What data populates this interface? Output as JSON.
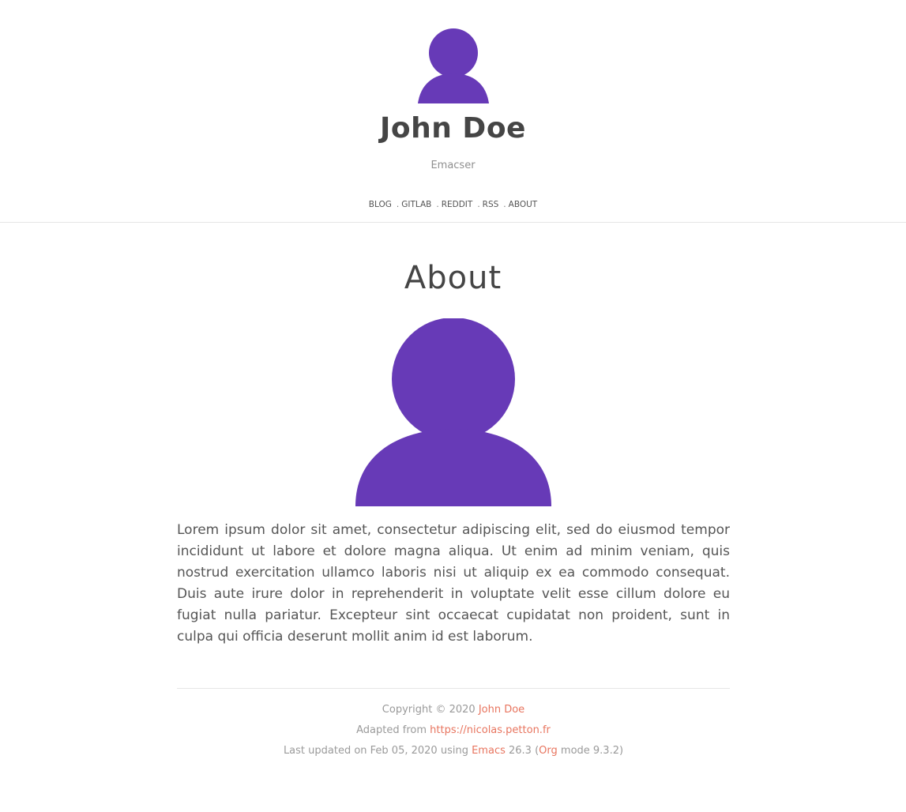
{
  "header": {
    "title": "John Doe",
    "subtitle": "Emacser",
    "nav": [
      "BLOG",
      "GITLAB",
      "REDDIT",
      "RSS",
      "ABOUT"
    ],
    "nav_separator": "."
  },
  "main": {
    "title": "About",
    "body": "Lorem ipsum dolor sit amet, consectetur adipiscing elit, sed do eiusmod tempor incididunt ut labore et dolore magna aliqua. Ut enim ad minim veniam, quis nostrud exercitation ullamco laboris nisi ut aliquip ex ea commodo consequat. Duis aute irure dolor in reprehenderit in voluptate velit esse cillum dolore eu fugiat nulla pariatur. Excepteur sint occaecat cupidatat non proident, sunt in culpa qui officia deserunt mollit anim id est laborum."
  },
  "footer": {
    "copyright_prefix": "Copyright © 2020",
    "copyright_link": "John Doe",
    "adapted_prefix": "Adapted from",
    "adapted_link": "https://nicolas.petton.fr",
    "updated_prefix": "Last updated on Feb 05, 2020 using",
    "emacs_link": "Emacs",
    "emacs_version": "26.3 (",
    "org_link": "Org",
    "org_version": "mode 9.3.2)"
  },
  "colors": {
    "avatar": "#673ab7",
    "link": "#e8755f",
    "text": "#4a4a4a",
    "muted": "#9a9a9a"
  },
  "icons": {
    "header_avatar": "user-avatar-icon",
    "about_avatar": "user-avatar-icon"
  }
}
